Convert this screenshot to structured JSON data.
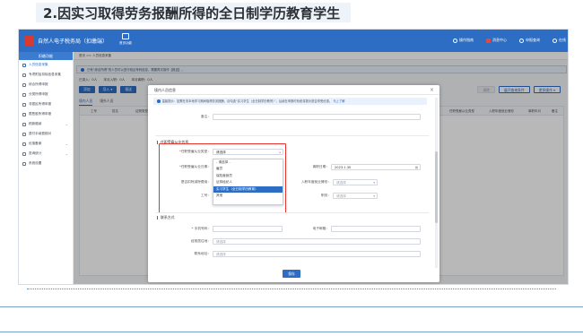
{
  "slide": {
    "title": "2.因实习取得劳务报酬所得的全日制学历教育学生"
  },
  "app": {
    "title": "自然人电子税务局（扣缴端）",
    "home_label": "首页功能",
    "top_actions": [
      "操作指南",
      "消息中心",
      "申报查询",
      "在线"
    ],
    "brand_color": "#2d6dc4"
  },
  "sidebar": {
    "header": "扣缴功能",
    "items": [
      {
        "label": "人员信息采集",
        "icon": "user-icon",
        "active": true
      },
      {
        "label": "专项附加扣除信息采集",
        "icon": "list-icon"
      },
      {
        "label": "综合所得申报",
        "icon": "doc-icon"
      },
      {
        "label": "分类所得申报",
        "icon": "doc-icon"
      },
      {
        "label": "非居民所得申报",
        "icon": "doc-icon"
      },
      {
        "label": "限售股所得申报",
        "icon": "doc-icon"
      },
      {
        "label": "税款缴纳",
        "icon": "coin-icon",
        "arrow": true
      },
      {
        "label": "退付手续费核对",
        "icon": "refund-icon"
      },
      {
        "label": "优惠备案",
        "icon": "file-icon",
        "arrow": true
      },
      {
        "label": "查询统计",
        "icon": "chart-icon",
        "arrow": true
      },
      {
        "label": "系统设置",
        "icon": "gear-icon"
      }
    ]
  },
  "main": {
    "breadcrumb": "首页 >> 人员信息采集",
    "notice": "已有“综合所得”的人员可以进行验证号码信息，需要再次操作【报送】。",
    "stats": [
      "已录入：0人",
      "本月入职：0人",
      "本月离职：0人"
    ],
    "buttons": [
      "添加",
      "导入 ▾",
      "报送"
    ],
    "right_buttons": [
      "展开查询条件",
      "更多操作 ▾"
    ],
    "disabled_button": "清除",
    "tabs": [
      "境内人员",
      "境外人员"
    ],
    "table_headers": [
      "工号",
      "姓名",
      "证照类型",
      "任职受雇从业类型",
      "入职年度就业情形",
      "离职年月",
      "备注"
    ]
  },
  "modal": {
    "title": "境内人员信息",
    "tip": "温馨提示：如需在非本地学习期间取得劳务报酬，请勾选“实习学生（全日制学历教育）”，后续在申报时系统将提示是否享受优惠。",
    "tip_link": "马上了解",
    "label_top": "备注：",
    "section_employment": "任职受雇从业信息",
    "employment_type_label": "任职受雇从业类型：",
    "employment_type_value": "请选择",
    "employment_date_label": "任职受雇从业日期：",
    "leave_date_label": "离职日期：",
    "leave_date_value": "2023.1.30",
    "disability_label": "是否扣除减除费用：",
    "work_type_label": "入职年度就业情形：",
    "work_type_value": "请选择",
    "post_label": "工号：",
    "post_value": "",
    "duty_label": "职务：",
    "duty_value": "请选择",
    "dropdown_options": [
      "- 请选择 -",
      "雇员",
      "保险营销员",
      "证券经纪人",
      "实习学生（全日制学历教育）",
      "其他"
    ],
    "dropdown_selected": "实习学生（全日制学历教育）",
    "section_contact": "联系方式",
    "mobile_label": "* 手机号码：",
    "email_label": "电子邮箱：",
    "address_label": "经常居住地：",
    "address_placeholder": "请选择",
    "contact_address_label": "联系地址：",
    "contact_address_placeholder": "请选择",
    "save_label": "保存"
  }
}
